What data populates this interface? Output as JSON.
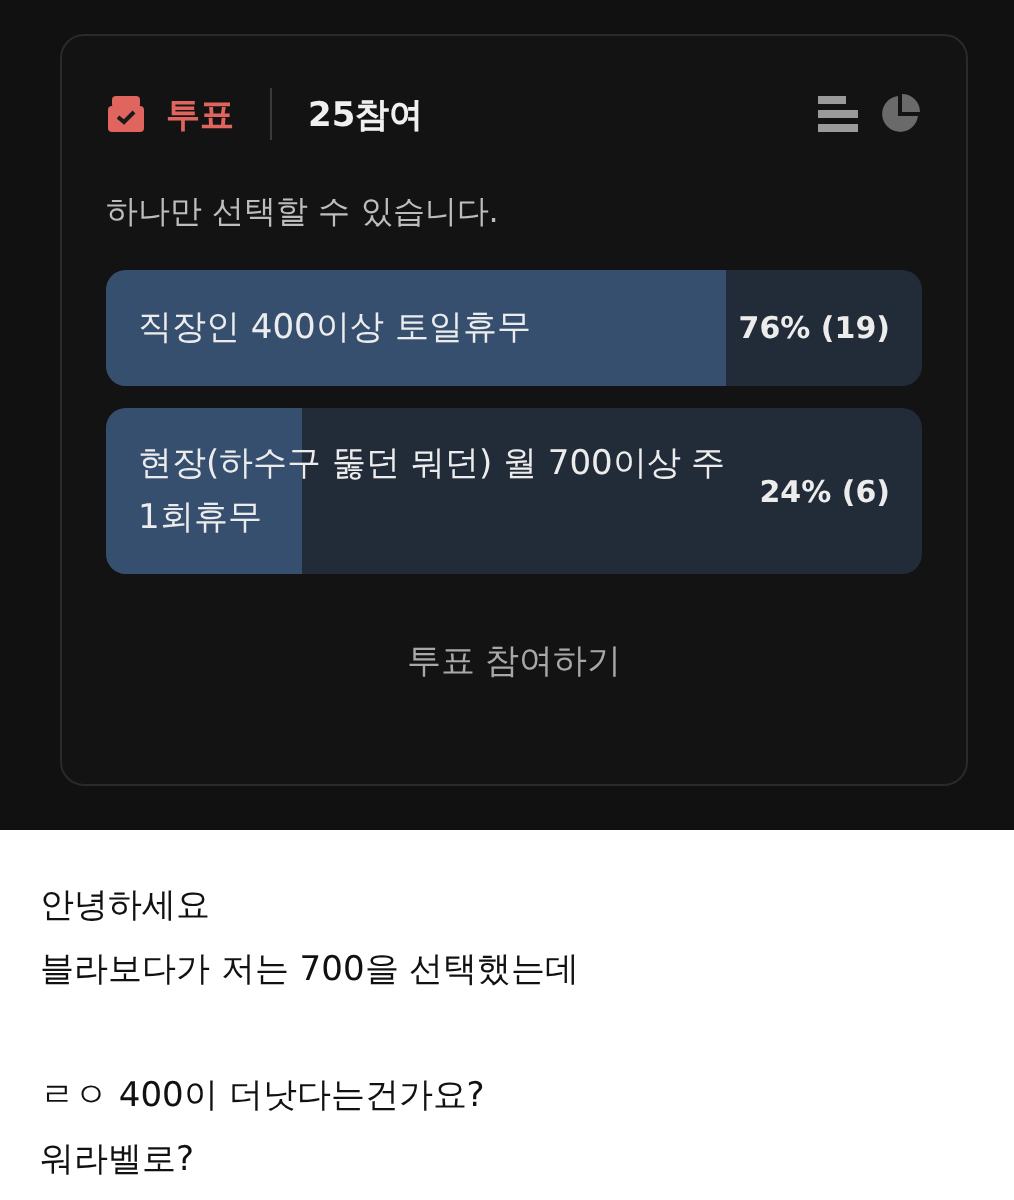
{
  "poll": {
    "label": "투표",
    "participants": "25참여",
    "instruction": "하나만 선택할 수 있습니다.",
    "options": [
      {
        "text": "직장인 400이상 토일휴무",
        "result": "76% (19)",
        "level": 0.76
      },
      {
        "text": "현장(하수구 뚫던 뭐던) 월 700이상 주1회휴무",
        "result": "24% (6)",
        "level": 0.24
      }
    ],
    "vote_button": "투표 참여하기"
  },
  "post": {
    "paragraphs": [
      [
        "안녕하세요",
        "블라보다가 저는 700을 선택했는데"
      ],
      [
        "ㄹㅇ 400이 더낫다는건가요?",
        "워라벨로?"
      ]
    ]
  }
}
